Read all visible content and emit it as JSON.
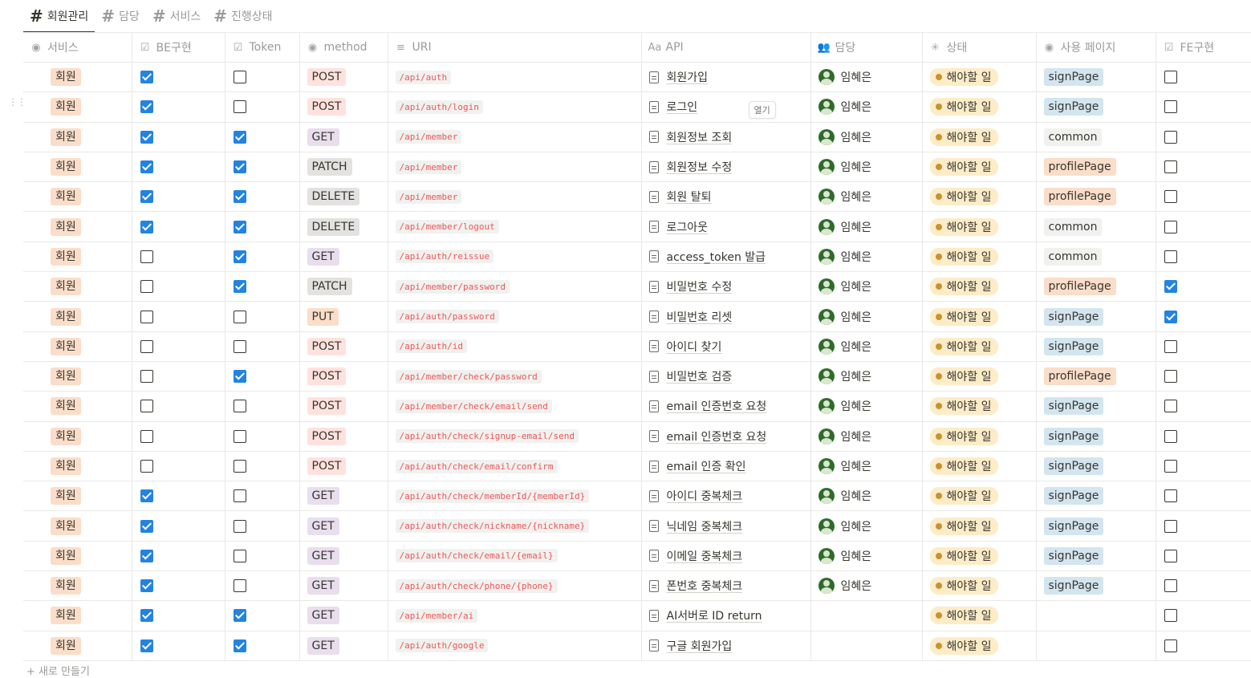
{
  "tabs": [
    {
      "label": "회원관리",
      "active": true
    },
    {
      "label": "담당",
      "active": false
    },
    {
      "label": "서비스",
      "active": false
    },
    {
      "label": "진행상태",
      "active": false
    }
  ],
  "columns": [
    {
      "key": "service",
      "label": "서비스",
      "icon": "select-icon"
    },
    {
      "key": "be",
      "label": "BE구현",
      "icon": "checkbox-icon"
    },
    {
      "key": "token",
      "label": "Token",
      "icon": "checkbox-icon"
    },
    {
      "key": "method",
      "label": "method",
      "icon": "select-icon"
    },
    {
      "key": "uri",
      "label": "URI",
      "icon": "text-icon"
    },
    {
      "key": "api",
      "label": "API",
      "icon": "title-icon",
      "icon_text": "Aa"
    },
    {
      "key": "assignee",
      "label": "담당",
      "icon": "person-icon"
    },
    {
      "key": "status",
      "label": "상태",
      "icon": "status-icon"
    },
    {
      "key": "page",
      "label": "사용 페이지",
      "icon": "select-icon"
    },
    {
      "key": "fe",
      "label": "FE구현",
      "icon": "checkbox-icon"
    }
  ],
  "open_button_label": "열기",
  "new_row_label": "+ 새로 만들기",
  "rows": [
    {
      "service": "회원",
      "be": true,
      "token": false,
      "method": "POST",
      "uri": "/api/auth",
      "api": "회원가입",
      "assignee": "임혜은",
      "status": "해야할 일",
      "page": "signPage",
      "fe": false
    },
    {
      "service": "회원",
      "be": true,
      "token": false,
      "method": "POST",
      "uri": "/api/auth/login",
      "api": "로그인",
      "assignee": "임혜은",
      "status": "해야할 일",
      "page": "signPage",
      "fe": false
    },
    {
      "service": "회원",
      "be": true,
      "token": true,
      "method": "GET",
      "uri": "/api/member",
      "api": "회원정보 조회",
      "assignee": "임혜은",
      "status": "해야할 일",
      "page": "common",
      "fe": false
    },
    {
      "service": "회원",
      "be": true,
      "token": true,
      "method": "PATCH",
      "uri": "/api/member",
      "api": "회원정보 수정",
      "assignee": "임혜은",
      "status": "해야할 일",
      "page": "profilePage",
      "fe": false
    },
    {
      "service": "회원",
      "be": true,
      "token": true,
      "method": "DELETE",
      "uri": "/api/member",
      "api": "회원 탈퇴",
      "assignee": "임혜은",
      "status": "해야할 일",
      "page": "profilePage",
      "fe": false
    },
    {
      "service": "회원",
      "be": true,
      "token": true,
      "method": "DELETE",
      "uri": "/api/member/logout",
      "api": "로그아웃",
      "assignee": "임혜은",
      "status": "해야할 일",
      "page": "common",
      "fe": false
    },
    {
      "service": "회원",
      "be": false,
      "token": true,
      "method": "GET",
      "uri": "/api/auth/reissue",
      "api": "access_token 발급",
      "assignee": "임혜은",
      "status": "해야할 일",
      "page": "common",
      "fe": false
    },
    {
      "service": "회원",
      "be": false,
      "token": true,
      "method": "PATCH",
      "uri": "/api/member/password",
      "api": "비밀번호 수정",
      "assignee": "임혜은",
      "status": "해야할 일",
      "page": "profilePage",
      "fe": true
    },
    {
      "service": "회원",
      "be": false,
      "token": false,
      "method": "PUT",
      "uri": "/api/auth/password",
      "api": "비밀번호 리셋",
      "assignee": "임혜은",
      "status": "해야할 일",
      "page": "signPage",
      "fe": true
    },
    {
      "service": "회원",
      "be": false,
      "token": false,
      "method": "POST",
      "uri": "/api/auth/id",
      "api": "아이디 찾기",
      "assignee": "임혜은",
      "status": "해야할 일",
      "page": "signPage",
      "fe": false
    },
    {
      "service": "회원",
      "be": false,
      "token": true,
      "method": "POST",
      "uri": "/api/member/check/password",
      "api": "비밀번호 검증",
      "assignee": "임혜은",
      "status": "해야할 일",
      "page": "profilePage",
      "fe": false
    },
    {
      "service": "회원",
      "be": false,
      "token": false,
      "method": "POST",
      "uri": "/api/member/check/email/send",
      "api": "email 인증번호 요청",
      "assignee": "임혜은",
      "status": "해야할 일",
      "page": "signPage",
      "fe": false
    },
    {
      "service": "회원",
      "be": false,
      "token": false,
      "method": "POST",
      "uri": "/api/auth/check/signup-email/send",
      "api": "email 인증번호 요청",
      "assignee": "임혜은",
      "status": "해야할 일",
      "page": "signPage",
      "fe": false
    },
    {
      "service": "회원",
      "be": false,
      "token": false,
      "method": "POST",
      "uri": "/api/auth/check/email/confirm",
      "api": "email 인증 확인",
      "assignee": "임혜은",
      "status": "해야할 일",
      "page": "signPage",
      "fe": false
    },
    {
      "service": "회원",
      "be": true,
      "token": false,
      "method": "GET",
      "uri": "/api/auth/check/memberId/{memberId}",
      "api": "아이디 중복체크",
      "assignee": "임혜은",
      "status": "해야할 일",
      "page": "signPage",
      "fe": false
    },
    {
      "service": "회원",
      "be": true,
      "token": false,
      "method": "GET",
      "uri": "/api/auth/check/nickname/{nickname}",
      "api": "닉네임 중복체크",
      "assignee": "임혜은",
      "status": "해야할 일",
      "page": "signPage",
      "fe": false
    },
    {
      "service": "회원",
      "be": true,
      "token": false,
      "method": "GET",
      "uri": "/api/auth/check/email/{email}",
      "api": "이메일 중복체크",
      "assignee": "임혜은",
      "status": "해야할 일",
      "page": "signPage",
      "fe": false
    },
    {
      "service": "회원",
      "be": true,
      "token": false,
      "method": "GET",
      "uri": "/api/auth/check/phone/{phone}",
      "api": "폰번호 중복체크",
      "assignee": "임혜은",
      "status": "해야할 일",
      "page": "signPage",
      "fe": false
    },
    {
      "service": "회원",
      "be": true,
      "token": true,
      "method": "GET",
      "uri": "/api/member/ai",
      "api": "AI서버로 ID return",
      "assignee": "",
      "status": "해야할 일",
      "page": "",
      "fe": false
    },
    {
      "service": "회원",
      "be": true,
      "token": true,
      "method": "GET",
      "uri": "/api/auth/google",
      "api": "구글 회원가입",
      "assignee": "",
      "status": "해야할 일",
      "page": "",
      "fe": false
    }
  ]
}
